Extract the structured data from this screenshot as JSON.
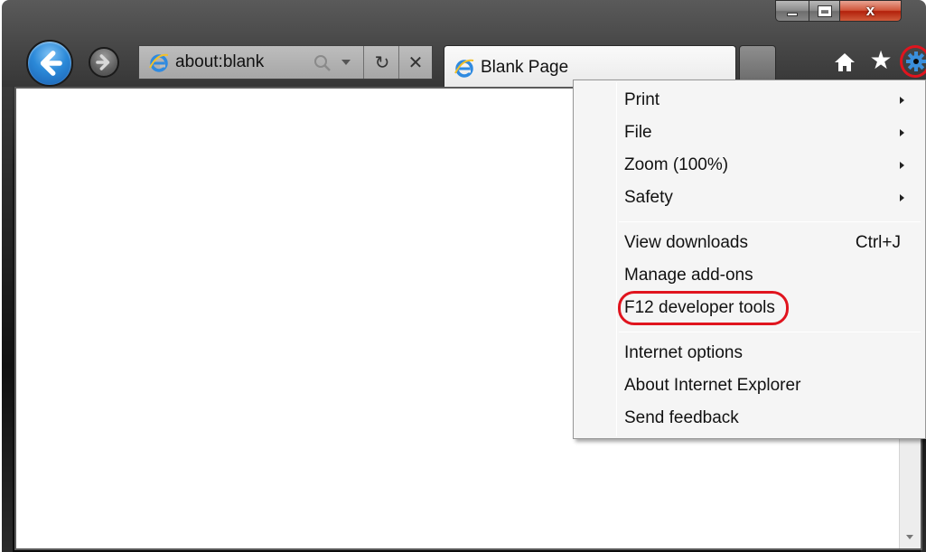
{
  "window": {
    "caption_buttons": [
      "minimize",
      "maximize",
      "close"
    ],
    "close_glyph": "x"
  },
  "nav": {
    "back_icon": "back-arrow-icon",
    "forward_icon": "forward-arrow-icon"
  },
  "address_bar": {
    "value": "about:blank",
    "icons": [
      "ie-logo-icon",
      "search-icon",
      "dropdown-icon",
      "refresh-icon",
      "stop-icon"
    ],
    "refresh_glyph": "↻",
    "stop_glyph": "✕"
  },
  "tabs": [
    {
      "label": "Blank Page",
      "active": true
    }
  ],
  "toolbar_icons": [
    "home-icon",
    "favorites-star-icon",
    "tools-gear-icon"
  ],
  "tools_menu": {
    "groups": [
      [
        {
          "label": "Print",
          "submenu": true
        },
        {
          "label": "File",
          "submenu": true
        },
        {
          "label": "Zoom (100%)",
          "submenu": true
        },
        {
          "label": "Safety",
          "submenu": true
        }
      ],
      [
        {
          "label": "View downloads",
          "shortcut": "Ctrl+J"
        },
        {
          "label": "Manage add-ons"
        },
        {
          "label": "F12 developer tools",
          "highlighted": true
        }
      ],
      [
        {
          "label": "Internet options"
        },
        {
          "label": "About Internet Explorer"
        },
        {
          "label": "Send feedback"
        }
      ]
    ]
  },
  "colors": {
    "highlight": "#e0141e",
    "back_button": "#2b89d8",
    "menu_background": "#f5f5f5"
  }
}
